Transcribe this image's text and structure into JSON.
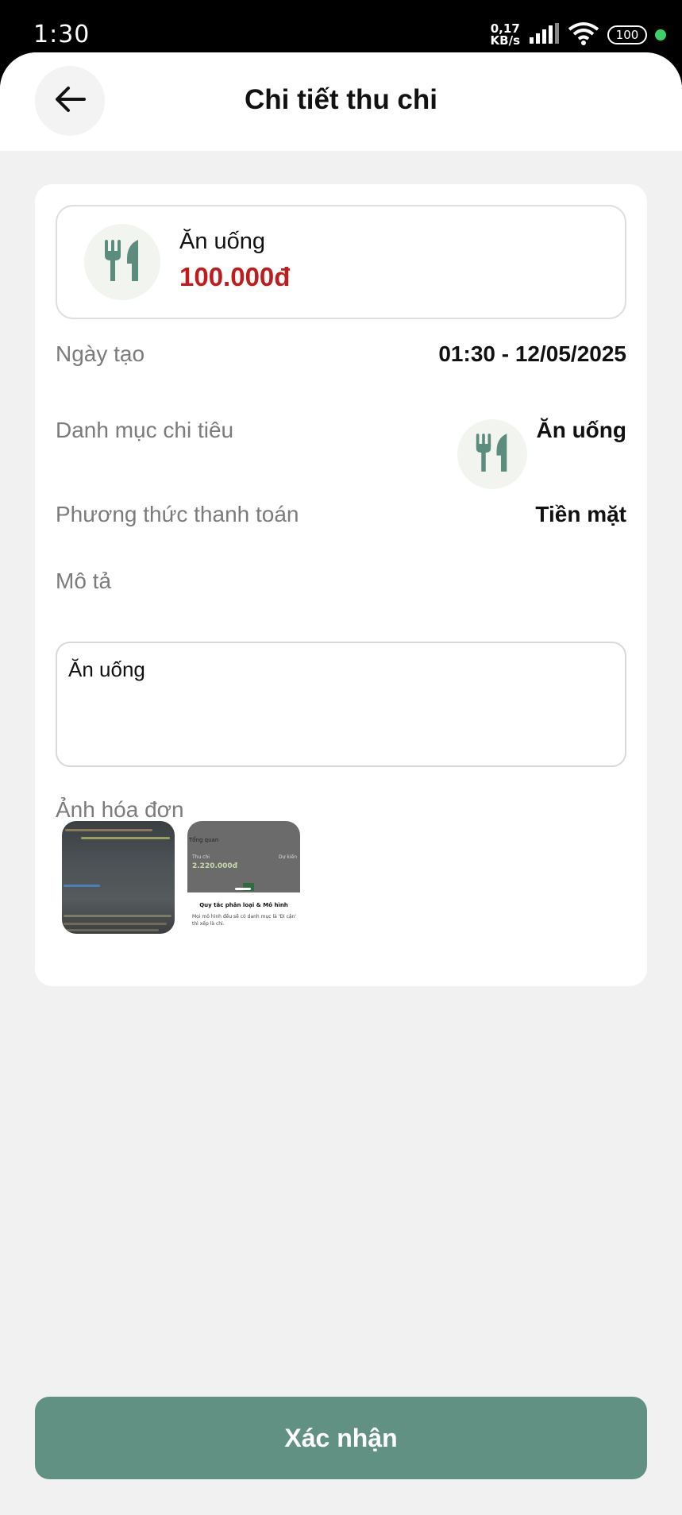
{
  "status_bar": {
    "time": "1:30",
    "net_speed_value": "0,17",
    "net_speed_unit": "KB/s",
    "battery": "100"
  },
  "header": {
    "title": "Chi tiết thu chi"
  },
  "summary": {
    "category_name": "Ăn uống",
    "amount": "100.000đ",
    "amount_color": "#bf1d1d",
    "icon": "fork-knife-icon"
  },
  "details": {
    "created_label": "Ngày tạo",
    "created_value": "01:30 - 12/05/2025",
    "category_label": "Danh mục chi tiêu",
    "category_value": "Ăn uống",
    "payment_label": "Phương thức thanh toán",
    "payment_value": "Tiền mặt",
    "description_label": "Mô tả",
    "description_value": "Ăn uống",
    "receipt_label": "Ảnh hóa đơn"
  },
  "receipt_thumbs": {
    "thumb2_header": "Tổng quan",
    "thumb2_left_label": "Thu chi",
    "thumb2_right_label": "Dự kiến",
    "thumb2_amount": "2.220.000đ",
    "thumb2_title": "Quy tắc phân loại & Mô hình",
    "thumb2_body": "Mọi mô hình đều sẽ có danh mục là 'Đi cận' thì xếp là chi."
  },
  "actions": {
    "confirm_label": "Xác nhận",
    "primary_color": "#619183"
  }
}
